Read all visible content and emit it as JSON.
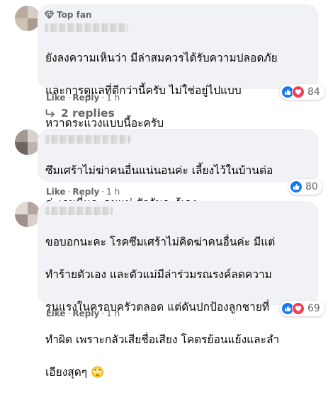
{
  "comments": [
    {
      "badge": "Top fan",
      "text_lines": [
        "ยังลงความเห็นว่า มีล่าสมควรได้รับความปลอดภัย",
        "และการดูแลที่ดีกว่านี้ครับ ไม่ใช่อยู่ไปแบบ",
        "หวาดระแวงแบบนี้อะครับ"
      ],
      "like_label": "Like",
      "reply_label": "Reply",
      "time": "1 h",
      "reaction_count": "84",
      "reactions": [
        "like-icon",
        "love-icon"
      ],
      "replies_label": "2 replies"
    },
    {
      "text_lines": [
        "ซึมเศร้าไม่ฆ่าคนอื่นแน่นอนค่ะ เลี้ยงไว้ในบ้านต่อ",
        "ค่ะเจนนี่และคุมแม่ สักวันจะรู้เอง"
      ],
      "like_label": "Like",
      "reply_label": "Reply",
      "time": "1 h",
      "reaction_count": "80",
      "reactions": [
        "like-icon"
      ]
    },
    {
      "text_lines": [
        "ขอบอกนะคะ โรคซึมเศร้าไม่คิดฆ่าคนอื่นค่ะ มีแต่",
        "ทำร้ายตัวเอง และตัวแม่มีล่าร่วมรณรงค์ลดความ",
        "รุนแรงในครอบครัวตลอด แต่ดันปกป้องลูกชายที่",
        "ทำผิด เพราะกลัวเสียชื่อเสียง โคตรย้อนแย้งและลำ",
        "เอียงสุดๆ 🙄"
      ],
      "like_label": "Like",
      "reply_label": "Reply",
      "time": "1 h",
      "reaction_count": "69",
      "reactions": [
        "like-icon",
        "love-icon"
      ]
    }
  ],
  "colors": {
    "bubble": "#f0f2f5",
    "meta_text": "#65676b",
    "like_blue": "#1877f2",
    "love_red": "#f33e58"
  }
}
